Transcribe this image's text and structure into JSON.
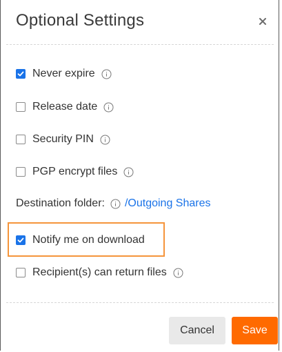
{
  "dialog": {
    "title": "Optional Settings",
    "close_icon": "close-icon"
  },
  "options": {
    "never_expire": {
      "label": "Never expire",
      "checked": true
    },
    "release_date": {
      "label": "Release date",
      "checked": false
    },
    "security_pin": {
      "label": "Security PIN",
      "checked": false
    },
    "pgp_encrypt": {
      "label": "PGP encrypt files",
      "checked": false
    },
    "notify_download": {
      "label": "Notify me on download",
      "checked": true
    },
    "recipient_return": {
      "label": "Recipient(s) can return files",
      "checked": false
    }
  },
  "destination": {
    "label": "Destination folder:",
    "value": "/Outgoing Shares"
  },
  "footer": {
    "cancel_label": "Cancel",
    "save_label": "Save"
  },
  "colors": {
    "checkbox_checked": "#1a73e8",
    "link": "#1a73e8",
    "save_button": "#ff6a00",
    "cancel_button": "#e9e9e9",
    "highlight_border": "#f5943a"
  }
}
